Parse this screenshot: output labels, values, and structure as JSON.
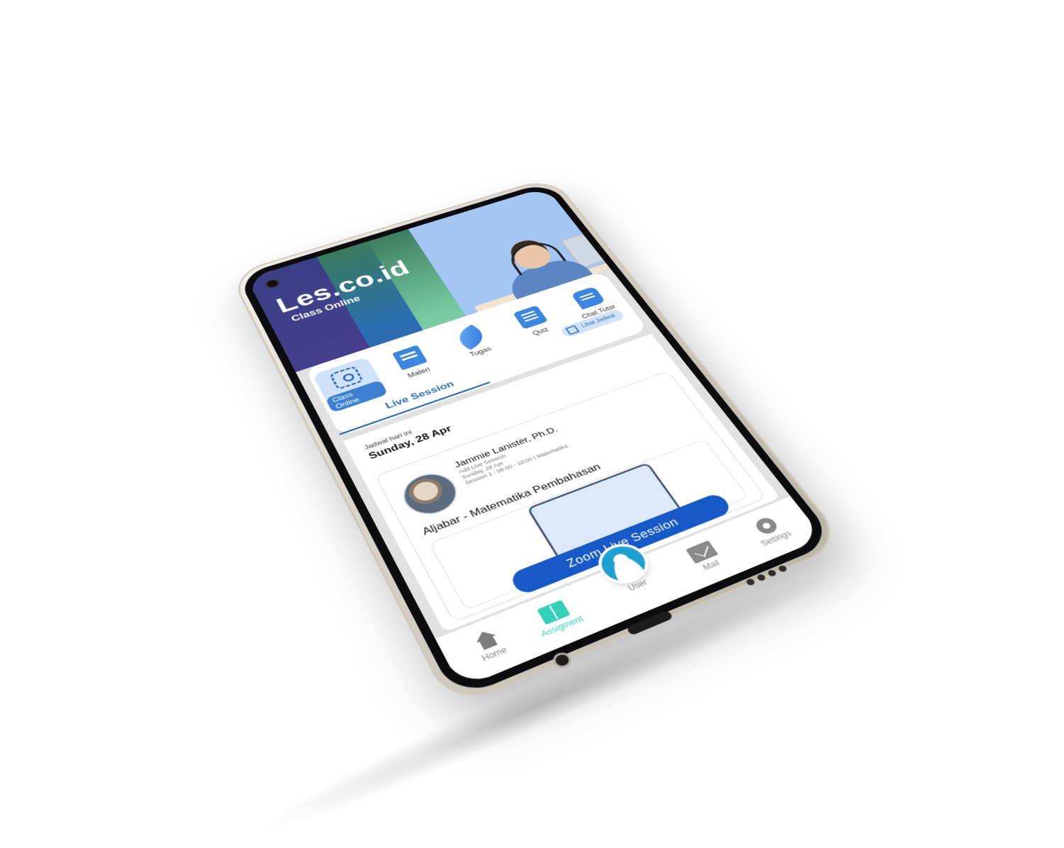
{
  "brand": {
    "name": "Les.co.id",
    "subtitle": "Class Online"
  },
  "menu": [
    {
      "label": "Class Online",
      "icon": "face-scan-icon",
      "active": true
    },
    {
      "label": "Materi",
      "icon": "book-icon"
    },
    {
      "label": "Tugas",
      "icon": "feather-icon"
    },
    {
      "label": "Quiz",
      "icon": "document-icon"
    },
    {
      "label": "Chat Tutor",
      "icon": "chat-icon"
    }
  ],
  "tabs": {
    "live_session": "Live Session",
    "lihat_jadwal": "Lihat Jadwal"
  },
  "schedule": {
    "label": "Jadwal hari ini",
    "date": "Sunday, 28 Apr"
  },
  "session": {
    "tutor_name": "Jammie Lanister, Ph.D.",
    "meta_line1": "Add Live Session",
    "meta_line2": "Sunday, 28 Apr",
    "meta_line3": "Session 1 : 08:00 - 10:00 | Matematika",
    "title": "Aljabar - Matematika Pembahasan",
    "zoom_button": "Zoom Live Session"
  },
  "bottom_nav": {
    "home": "Home",
    "assignment": "Assigment",
    "user": "User",
    "mail": "Mail",
    "settings": "Settings"
  },
  "colors": {
    "accent": "#1659c7",
    "active_nav": "#33d1b8",
    "hero_bg": "#a5c6f5"
  }
}
